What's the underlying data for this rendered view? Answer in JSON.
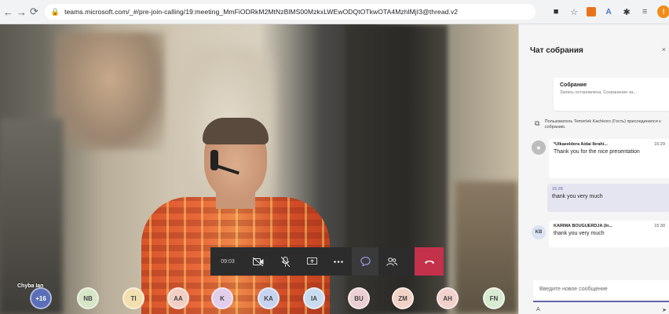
{
  "browser": {
    "back_icon": "arrow-left",
    "forward_icon": "arrow-right",
    "reload_icon": "reload",
    "url": "teams.microsoft.com/_#/pre-join-calling/19:meeting_MmFiODRkM2MtNzBlMS00MzkxLWEwODQtOTkwOTA4MzhlMjI3@thread.v2"
  },
  "video": {
    "participant_name": "Chyba Ian",
    "call_time": "09:03",
    "controls": [
      {
        "name": "camera-off-icon",
        "glyph": "■"
      },
      {
        "name": "mic-off-icon",
        "glyph": "🎙"
      },
      {
        "name": "share-screen-icon",
        "glyph": "▭"
      },
      {
        "name": "more-options-icon",
        "glyph": "•••"
      },
      {
        "name": "chat-icon",
        "glyph": "💬"
      },
      {
        "name": "participants-icon",
        "glyph": "👥"
      },
      {
        "name": "hang-up-icon",
        "glyph": "☎"
      }
    ],
    "avatars": [
      {
        "initials": "+16",
        "color": "#5a6fb7"
      },
      {
        "initials": "NB",
        "color": "#d6e5c6"
      },
      {
        "initials": "TI",
        "color": "#f2dfb0"
      },
      {
        "initials": "AA",
        "color": "#f3cfc3"
      },
      {
        "initials": "K",
        "color": "#e2cdeb"
      },
      {
        "initials": "KA",
        "color": "#c7d4f0"
      },
      {
        "initials": "IA",
        "color": "#c9dcef"
      },
      {
        "initials": "BU",
        "color": "#ebcfd3"
      },
      {
        "initials": "ZM",
        "color": "#f1d2c4"
      },
      {
        "initials": "AH",
        "color": "#f2d0cb"
      },
      {
        "initials": "FN",
        "color": "#d8ead0"
      }
    ]
  },
  "chat": {
    "title": "Чат собрания",
    "meeting_card": {
      "title": "Собрание",
      "subtitle": "Запись остановлена. Сохранение за..."
    },
    "system_message": "Пользователь Temerlek Kachkoro (Гость) присоединился к собранию.",
    "messages": [
      {
        "author": "*Ulkaeeldera Aidai Ibrahi...",
        "time": "15:29",
        "text": "Thank you for the nice presentation",
        "avatar": ""
      },
      {
        "author": "",
        "time": "15:28",
        "text": "thank you very much",
        "own": true
      },
      {
        "author": "KARIMA BOUGUERDJA (In...",
        "time": "15:30",
        "text": "thank you very much",
        "avatar": "KB"
      }
    ],
    "compose_placeholder": "Введите новое сообщение",
    "format_icon": "A",
    "send_icon": "send"
  },
  "colors": {
    "teams_purple": "#6264a7",
    "hangup_red": "#c4314b",
    "controls_bg": "#2d2c2c"
  }
}
